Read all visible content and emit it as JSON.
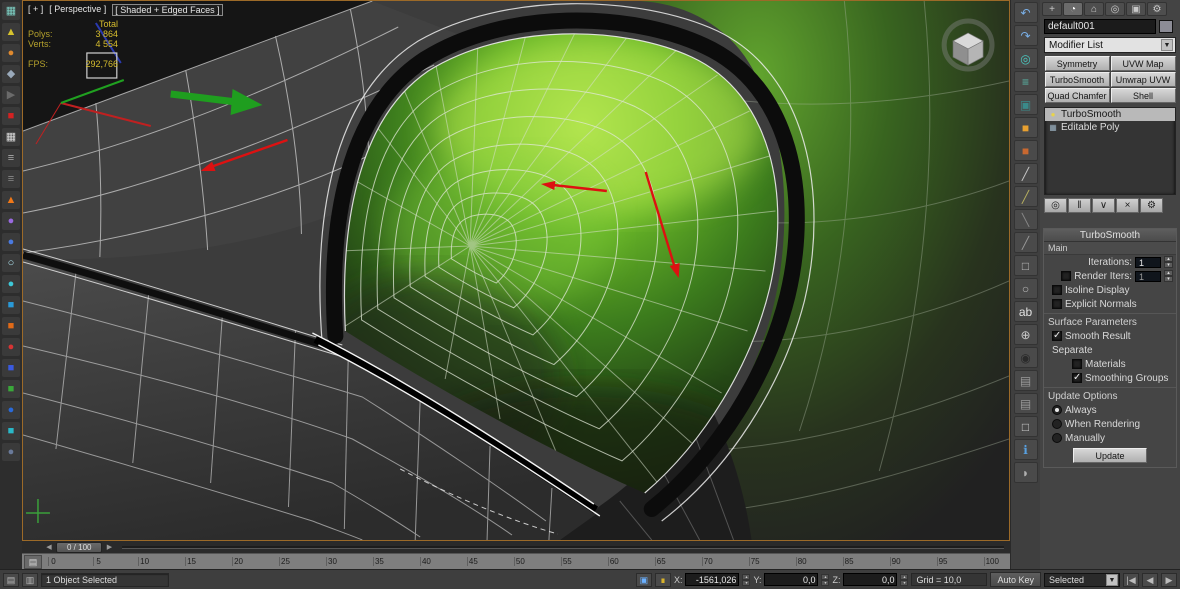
{
  "colors": {
    "viewport_border": "#9c6a28",
    "glow_green": "#8fd43e",
    "annotation_red": "#dd1111",
    "annotation_green": "#1f9e1f"
  },
  "glyphs": {
    "listener": "▤",
    "explorer": "▥",
    "isolate": "▣",
    "lock": "∎",
    "dd_arrow": "▼",
    "prev": "◀",
    "next": "▶",
    "start": "|◀",
    "ruler_icon": "▤",
    "spin_up": "▴",
    "spin_down": "▾"
  },
  "viewport": {
    "menu": {
      "plus": "[ + ]",
      "pov": "[ Perspective ]",
      "shading": "[ Shaded + Edged Faces ]"
    },
    "stats": {
      "total_label": "Total",
      "polys_label": "Polys:",
      "polys_value": "3 864",
      "verts_label": "Verts:",
      "verts_value": "4 554",
      "fps_label": "FPS:",
      "fps_value": "292,766"
    }
  },
  "left_toolbar": {
    "icons": [
      {
        "name": "select-link-icon",
        "glyph": "▦",
        "color": "#7fd4c8"
      },
      {
        "name": "snaps-toggle-icon",
        "glyph": "▲",
        "color": "#d6c32e"
      },
      {
        "name": "material-sphere-icon",
        "glyph": "●",
        "color": "#e08a2e"
      },
      {
        "name": "angle-snap-icon",
        "glyph": "◆",
        "color": "#9aaabb"
      },
      {
        "name": "play-arrow-icon",
        "glyph": "▶",
        "color": "#6a6a6a"
      },
      {
        "name": "mirror-icon",
        "glyph": "■",
        "color": "#d42222"
      },
      {
        "name": "grid-icon",
        "glyph": "▦",
        "color": "#dddddd"
      },
      {
        "name": "layer-list-icon",
        "glyph": "≡",
        "color": "#aaaaaa"
      },
      {
        "name": "array-icon",
        "glyph": "≡",
        "color": "#8a8a8a"
      },
      {
        "name": "flame-icon",
        "glyph": "▲",
        "color": "#f07818"
      },
      {
        "name": "space-warp-icon",
        "glyph": "●",
        "color": "#9a6ae0"
      },
      {
        "name": "bind-icon",
        "glyph": "●",
        "color": "#4a7ae0"
      },
      {
        "name": "snow-icon",
        "glyph": "○",
        "color": "#aee3f0"
      },
      {
        "name": "water-drop-icon",
        "glyph": "●",
        "color": "#3ec8d8"
      },
      {
        "name": "ocean-icon",
        "glyph": "■",
        "color": "#2a9ad8"
      },
      {
        "name": "lava-icon",
        "glyph": "■",
        "color": "#e06a18"
      },
      {
        "name": "fire-icon",
        "glyph": "●",
        "color": "#d83434"
      },
      {
        "name": "sky-icon",
        "glyph": "■",
        "color": "#3a5ae0"
      },
      {
        "name": "grass-icon",
        "glyph": "■",
        "color": "#3aa83a"
      },
      {
        "name": "sea-icon",
        "glyph": "●",
        "color": "#2a6ad8"
      },
      {
        "name": "ice-icon",
        "glyph": "■",
        "color": "#2ab8c8"
      },
      {
        "name": "stone-icon",
        "glyph": "●",
        "color": "#6a7a9a"
      }
    ]
  },
  "right_strip": {
    "icons": [
      {
        "name": "undo-view-icon",
        "glyph": "↶",
        "color": "#7ab0e8"
      },
      {
        "name": "redo-view-icon",
        "glyph": "↷",
        "color": "#7ab0e8"
      },
      {
        "name": "select-object-icon",
        "glyph": "◎",
        "color": "#4ac8c0"
      },
      {
        "name": "layer-manager-icon",
        "glyph": "≡",
        "color": "#58b8a8"
      },
      {
        "name": "graphite-tools-icon",
        "glyph": "▣",
        "color": "#3a8a8a"
      },
      {
        "name": "material-editor-icon",
        "glyph": "■",
        "color": "#e8a030"
      },
      {
        "name": "render-setup-icon",
        "glyph": "■",
        "color": "#c86830"
      },
      {
        "name": "pencil-icon",
        "glyph": "╱",
        "color": "#c8c8c8"
      },
      {
        "name": "measure-icon",
        "glyph": "╱",
        "color": "#b8b060"
      },
      {
        "name": "pen-icon",
        "glyph": "╲",
        "color": "#888888"
      },
      {
        "name": "knife-icon",
        "glyph": "╱",
        "color": "#999999"
      },
      {
        "name": "marquee-select-icon",
        "glyph": "□",
        "color": "#bbbbbb"
      },
      {
        "name": "circle-select-icon",
        "glyph": "○",
        "color": "#bbbbbb"
      },
      {
        "name": "text-tool-icon",
        "glyph": "ab",
        "color": "#e0e0e0"
      },
      {
        "name": "crosshair-icon",
        "glyph": "⊕",
        "color": "#c8c8c8"
      },
      {
        "name": "record-icon",
        "glyph": "◉",
        "color": "#2a2a2a"
      },
      {
        "name": "monitor-icon",
        "glyph": "▤",
        "color": "#9a9a9a"
      },
      {
        "name": "monitor2-icon",
        "glyph": "▤",
        "color": "#9a9a9a"
      },
      {
        "name": "document-icon",
        "glyph": "□",
        "color": "#cfcfcf"
      },
      {
        "name": "info-icon",
        "glyph": "ℹ",
        "color": "#58a0e0"
      },
      {
        "name": "teapot-icon",
        "glyph": "◗",
        "color": "#b0b0b0"
      }
    ]
  },
  "command_panel": {
    "active_tab": 1,
    "tabs": [
      {
        "name": "tab-create-icon",
        "glyph": "+"
      },
      {
        "name": "tab-modify-icon",
        "glyph": "◔"
      },
      {
        "name": "tab-hierarchy-icon",
        "glyph": "⌂"
      },
      {
        "name": "tab-motion-icon",
        "glyph": "◎"
      },
      {
        "name": "tab-display-icon",
        "glyph": "▣"
      },
      {
        "name": "tab-utilities-icon",
        "glyph": "⚙"
      }
    ],
    "object_name": "default001",
    "modifier_list_label": "Modifier List",
    "modifier_buttons": [
      "Symmetry",
      "UVW Map",
      "TurboSmooth",
      "Unwrap UVW",
      "Quad Chamfer",
      "Shell"
    ],
    "stack": [
      {
        "label": "TurboSmooth",
        "icon": "●",
        "selected": true
      },
      {
        "label": "Editable Poly",
        "icon": "▦",
        "selected": false
      }
    ],
    "stack_tools": [
      {
        "name": "pin-stack-button",
        "glyph": "◎"
      },
      {
        "name": "show-end-result-button",
        "glyph": "‖"
      },
      {
        "name": "make-unique-button",
        "glyph": "∨"
      },
      {
        "name": "remove-modifier-button",
        "glyph": "×"
      },
      {
        "name": "configure-modifier-sets-button",
        "glyph": "⚙"
      }
    ],
    "rollout": {
      "title": "TurboSmooth",
      "main_label": "Main",
      "iterations_label": "Iterations:",
      "iterations_value": "1",
      "render_iters_label": "Render Iters:",
      "render_iters_value": "1",
      "isoline_label": "Isoline Display",
      "explicit_label": "Explicit Normals",
      "surface_params_label": "Surface Parameters",
      "smooth_result_label": "Smooth Result",
      "separate_label": "Separate",
      "materials_label": "Materials",
      "smoothing_groups_label": "Smoothing Groups",
      "update_options_label": "Update Options",
      "always_label": "Always",
      "when_rendering_label": "When Rendering",
      "manually_label": "Manually",
      "update_button": "Update"
    }
  },
  "timeline": {
    "slider_label": "0 / 100",
    "ticks": [
      "0",
      "5",
      "10",
      "15",
      "20",
      "25",
      "30",
      "35",
      "40",
      "45",
      "50",
      "55",
      "60",
      "65",
      "70",
      "75",
      "80",
      "85",
      "90",
      "95",
      "100"
    ]
  },
  "status_bar": {
    "selection_text": "1 Object Selected",
    "x_label": "X:",
    "x_value": "-1561,026",
    "y_label": "Y:",
    "y_value": "0,0",
    "z_label": "Z:",
    "z_value": "0,0",
    "grid_text": "Grid = 10,0",
    "auto_key_label": "Auto Key",
    "selected_dropdown": "Selected"
  }
}
